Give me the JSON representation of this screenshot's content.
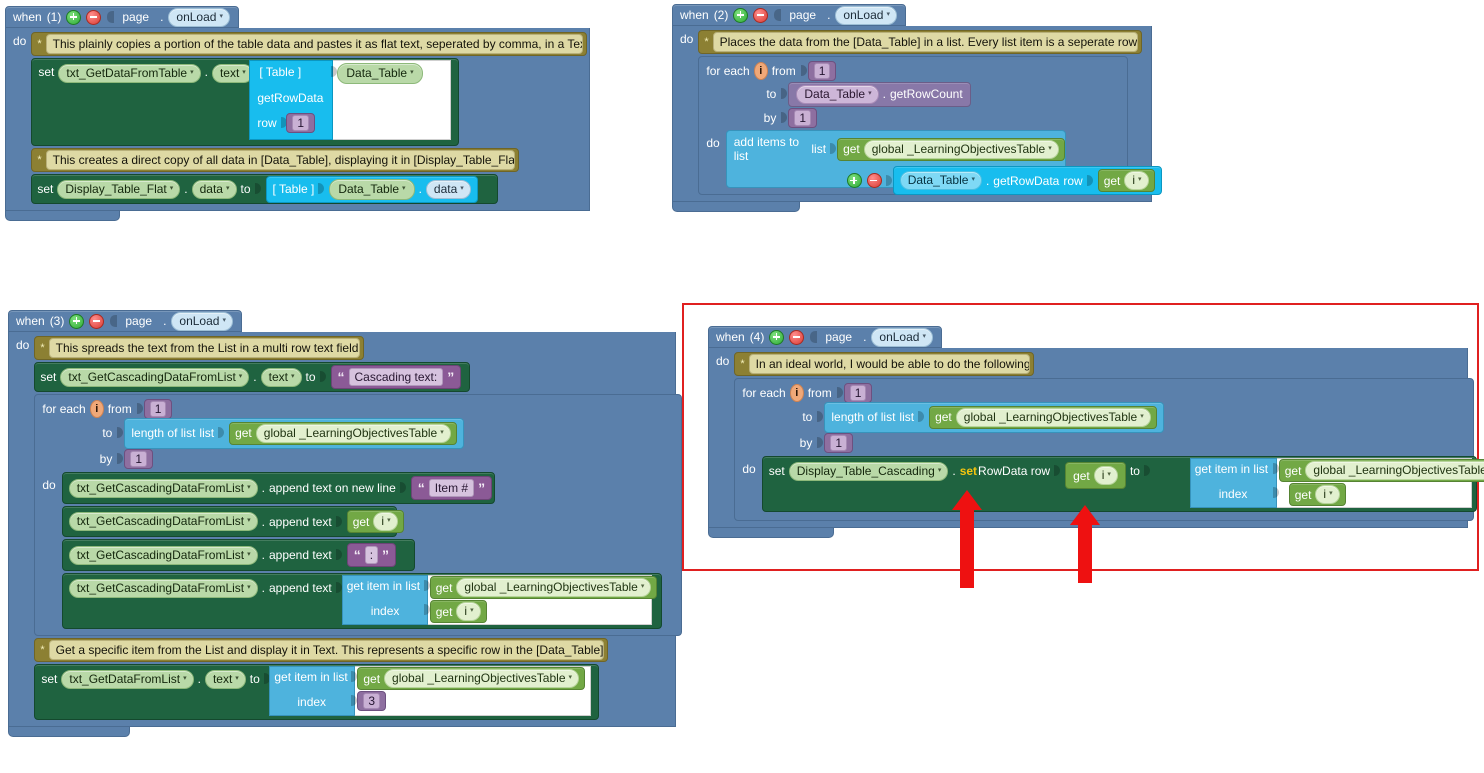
{
  "common": {
    "when_label": "when",
    "do_label": "do",
    "to_label": "to",
    "by_label": "by",
    "from_label": "from",
    "set_label": "set",
    "get_label": "get",
    "index_label": "index",
    "list_label": "list",
    "row_label": "row",
    "for_each_label": "for each",
    "dot": ".",
    "comment_star": "*",
    "caret": "▾",
    "loop_var": "i",
    "page_component": "page",
    "on_load_event": "onLoad",
    "data_table": "Data_Table",
    "global_list": "global _LearningObjectivesTable",
    "table_socket": "[ Table ]",
    "get_row_data": "getRowData",
    "get_row_count": "getRowCount",
    "length_of_list": "length of list",
    "get_item_in_list": "get item in list",
    "add_items_to_list": "add items to list",
    "append_text": "append text",
    "append_text_new_line": "append text on new line",
    "icons": {
      "mutator_add": "plus-circle-icon",
      "mutator_remove": "minus-circle-icon",
      "dropdown": "chevron-down-icon"
    },
    "colors": {
      "event_block": "#5b80ab",
      "statement_block": "#1f6340",
      "component_block": "#18bdee",
      "list_block": "#4eb3dd",
      "variable_block": "#72a845",
      "text_block": "#8b5a96",
      "math_block": "#8e6fa0",
      "comment_block": "#8c8033",
      "annotation_red": "#ee1111"
    }
  },
  "block1": {
    "title_index": "(1)",
    "comment1": "This plainly copies a portion of the table data and pastes it as flat text, seperated by comma, in a Text",
    "set1_component": "txt_GetDataFromTable",
    "set1_property": "text",
    "set1_value_row": "1",
    "comment2": "This creates a direct copy of all data in [Data_Table], displaying it in [Display_Table_Flat]",
    "set2_component": "Display_Table_Flat",
    "set2_property": "data",
    "set2_value_property": "data"
  },
  "block2": {
    "title_index": "(2)",
    "comment1": "Places the data from the [Data_Table] in a list. Every list item is a seperate row.",
    "from_value": "1",
    "by_value": "1"
  },
  "block3": {
    "title_index": "(3)",
    "comment1": "This spreads the text from the List in a multi row text field.",
    "set1_component": "txt_GetCascadingDataFromList",
    "set1_property": "text",
    "set1_text_value": "Cascading text:",
    "from_value": "1",
    "by_value": "1",
    "append_rows": [
      {
        "component": "txt_GetCascadingDataFromList",
        "method": "append text on new line",
        "value_kind": "text",
        "value": "Item #"
      },
      {
        "component": "txt_GetCascadingDataFromList",
        "method": "append text",
        "value_kind": "get",
        "value": "i"
      },
      {
        "component": "txt_GetCascadingDataFromList",
        "method": "append text",
        "value_kind": "text",
        "value": ":"
      },
      {
        "component": "txt_GetCascadingDataFromList",
        "method": "append text",
        "value_kind": "listitem",
        "value": "i"
      }
    ],
    "comment2": "Get a specific item from the List and display it in Text. This represents a specific row in the [Data_Table]",
    "set2_component": "txt_GetDataFromList",
    "set2_property": "text",
    "set2_index_value": "3"
  },
  "block4": {
    "title_index": "(4)",
    "comment1": "In an ideal world, I would be able to do the following:",
    "from_value": "1",
    "by_value": "1",
    "set_component": "Display_Table_Cascading",
    "set_method_highlight": "set",
    "set_method_rest": "RowData row",
    "row_value": "i",
    "index_value": "i",
    "annotation_arrow_1": "red-arrow-up",
    "annotation_arrow_2": "red-arrow-up"
  }
}
